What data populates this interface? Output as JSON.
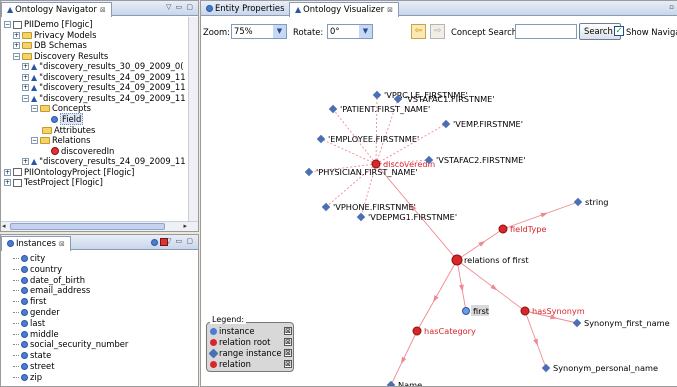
{
  "navigator": {
    "tab_title": "Ontology Navigator",
    "close_glyph": "⊠",
    "view_controls": "▽ ▭ ▢",
    "tree": [
      {
        "label": "PIIDemo [Flogic]",
        "toggle": "−",
        "icon": "project",
        "level": 0
      },
      {
        "label": "Privacy Models",
        "toggle": "+",
        "icon": "folder",
        "level": 1
      },
      {
        "label": "DB Schemas",
        "toggle": "+",
        "icon": "folder",
        "level": 1
      },
      {
        "label": "Discovery Results",
        "toggle": "−",
        "icon": "folder",
        "level": 1
      },
      {
        "label": "\"discovery_results_30_09_2009_0(",
        "toggle": "+",
        "icon": "ontology",
        "level": 2
      },
      {
        "label": "\"discovery_results_24_09_2009_11",
        "toggle": "+",
        "icon": "ontology",
        "level": 2
      },
      {
        "label": "\"discovery_results_24_09_2009_11",
        "toggle": "+",
        "icon": "ontology",
        "level": 2
      },
      {
        "label": "\"discovery_results_24_09_2009_11",
        "toggle": "−",
        "icon": "ontology",
        "level": 2
      },
      {
        "label": "Concepts",
        "toggle": "−",
        "icon": "folder",
        "level": 3
      },
      {
        "label": "Field",
        "toggle": "",
        "icon": "concept",
        "level": 4,
        "selected": true
      },
      {
        "label": "Attributes",
        "toggle": "",
        "icon": "folder",
        "level": 3
      },
      {
        "label": "Relations",
        "toggle": "−",
        "icon": "folder",
        "level": 3
      },
      {
        "label": "discoveredIn",
        "toggle": "",
        "icon": "relation",
        "level": 4
      },
      {
        "label": "\"discovery_results_24_09_2009_11",
        "toggle": "+",
        "icon": "ontology",
        "level": 2
      },
      {
        "label": "PIIOntologyProject [Flogic]",
        "toggle": "+",
        "icon": "project",
        "level": 0
      },
      {
        "label": "TestProject [Flogic]",
        "toggle": "+",
        "icon": "project",
        "level": 0
      }
    ]
  },
  "instances": {
    "tab_title": "Instances",
    "close_glyph": "⊠",
    "view_controls": "▽ ▭ ▢",
    "items": [
      "city",
      "country",
      "date_of_birth",
      "email_address",
      "first",
      "gender",
      "last",
      "middle",
      "social_security_number",
      "state",
      "street",
      "zip"
    ]
  },
  "editor": {
    "tabs": [
      {
        "label": "Entity Properties",
        "active": false
      },
      {
        "label": "Ontology Visualizer",
        "active": true
      }
    ],
    "close_glyph": "⊠"
  },
  "toolbar": {
    "zoom_label": "Zoom:",
    "zoom_value": "75%",
    "rotate_label": "Rotate:",
    "rotate_value": "0°",
    "back_glyph": "⇦",
    "forward_glyph": "⇨",
    "concept_search_label": "Concept Search:",
    "concept_search_value": "",
    "search_button": "Search!",
    "show_navigation_label": "Show Navigatio",
    "show_navigation_checked": true
  },
  "graph": {
    "nodes": [
      {
        "id": "vprc",
        "label": "'VPRC.LE_FIRSTNME'",
        "kind": "range"
      },
      {
        "id": "vstafac1",
        "label": "'VSTAFAC1.FIRSTNME'",
        "kind": "range"
      },
      {
        "id": "patient",
        "label": "'PATIENT.FIRST_NAME'",
        "kind": "range"
      },
      {
        "id": "vemp",
        "label": "'VEMP.FIRSTNME'",
        "kind": "range"
      },
      {
        "id": "employee",
        "label": "'EMPLOYEE.FIRSTNME'",
        "kind": "range"
      },
      {
        "id": "discoveredin",
        "label": "discoveredIn",
        "kind": "relation"
      },
      {
        "id": "vstafac2",
        "label": "'VSTAFAC2.FIRSTNME'",
        "kind": "range"
      },
      {
        "id": "physician",
        "label": "'PHYSICIAN.FIRST_NAME'",
        "kind": "range"
      },
      {
        "id": "vphone",
        "label": "'VPHONE.FIRSTNME'",
        "kind": "range"
      },
      {
        "id": "vdepmg1",
        "label": "'VDEPMG1.FIRSTNME'",
        "kind": "range"
      },
      {
        "id": "string",
        "label": "string",
        "kind": "range"
      },
      {
        "id": "fieldtype",
        "label": "fieldType",
        "kind": "relation"
      },
      {
        "id": "relfirst",
        "label": "relations of first",
        "kind": "root"
      },
      {
        "id": "first",
        "label": "first",
        "kind": "instance"
      },
      {
        "id": "hassynonym",
        "label": "hasSynonym",
        "kind": "relation"
      },
      {
        "id": "synfirst",
        "label": "Synonym_first_name",
        "kind": "range"
      },
      {
        "id": "hascategory",
        "label": "hasCategory",
        "kind": "relation"
      },
      {
        "id": "synpersonal",
        "label": "Synonym_personal_name",
        "kind": "range"
      },
      {
        "id": "name",
        "label": "Name",
        "kind": "range"
      }
    ],
    "edges": [
      [
        "discoveredin",
        "vprc"
      ],
      [
        "discoveredin",
        "vstafac1"
      ],
      [
        "discoveredin",
        "patient"
      ],
      [
        "discoveredin",
        "vemp"
      ],
      [
        "discoveredin",
        "employee"
      ],
      [
        "discoveredin",
        "vstafac2"
      ],
      [
        "discoveredin",
        "physician"
      ],
      [
        "discoveredin",
        "vphone"
      ],
      [
        "discoveredin",
        "vdepmg1"
      ],
      [
        "relfirst",
        "discoveredin"
      ],
      [
        "relfirst",
        "fieldtype"
      ],
      [
        "fieldtype",
        "string"
      ],
      [
        "relfirst",
        "first"
      ],
      [
        "relfirst",
        "hassynonym"
      ],
      [
        "hassynonym",
        "synfirst"
      ],
      [
        "hassynonym",
        "synpersonal"
      ],
      [
        "relfirst",
        "hascategory"
      ],
      [
        "hascategory",
        "name"
      ]
    ]
  },
  "legend": {
    "title": "Legend:",
    "items": [
      {
        "label": "instance",
        "icon": "instance"
      },
      {
        "label": "relation root",
        "icon": "root"
      },
      {
        "label": "range instance",
        "icon": "range"
      },
      {
        "label": "relation",
        "icon": "relation"
      }
    ],
    "toggle_glyph": "⊠"
  },
  "colors": {
    "relation_red": "#d8262b",
    "range_blue": "#4a6fb5",
    "edge_pink": "#ef8a92",
    "title_blue": "#1d3d7a"
  }
}
